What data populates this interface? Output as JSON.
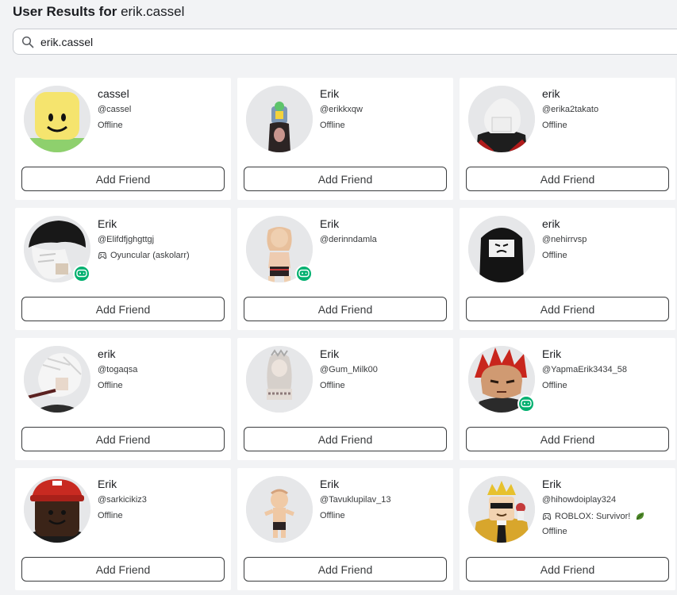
{
  "header": {
    "prefix": "User Results for",
    "query": "erik.cassel"
  },
  "search": {
    "value": "erik.cassel"
  },
  "add_friend_label": "Add Friend",
  "results": [
    {
      "display_name": "cassel",
      "username": "@cassel",
      "status": "Offline",
      "status2": "",
      "game": false,
      "avatar": "noob-yellow"
    },
    {
      "display_name": "Erik",
      "username": "@erikkxqw",
      "status": "Offline",
      "status2": "",
      "game": false,
      "avatar": "figure-mask"
    },
    {
      "display_name": "erik",
      "username": "@erika2takato",
      "status": "Offline",
      "status2": "",
      "game": false,
      "avatar": "white-hair-red"
    },
    {
      "display_name": "Erik",
      "username": "@Elifdfjghgttgj",
      "status": "Oyuncular (askolarr)",
      "status2": "",
      "game": true,
      "avatar": "black-beanie"
    },
    {
      "display_name": "Erik",
      "username": "@derinndamla",
      "status": "",
      "status2": "",
      "game": true,
      "avatar": "blonde-figure"
    },
    {
      "display_name": "erik",
      "username": "@nehirrvsp",
      "status": "Offline",
      "status2": "",
      "game": false,
      "avatar": "black-hair"
    },
    {
      "display_name": "erik",
      "username": "@togaqsa",
      "status": "Offline",
      "status2": "",
      "game": false,
      "avatar": "white-hair-sword"
    },
    {
      "display_name": "Erik",
      "username": "@Gum_Milk00",
      "status": "Offline",
      "status2": "",
      "game": false,
      "avatar": "faded-figure"
    },
    {
      "display_name": "Erik",
      "username": "@YapmaErik3434_58",
      "status": "Offline",
      "status2": "",
      "game": true,
      "avatar": "red-spiky"
    },
    {
      "display_name": "Erik",
      "username": "@sarkicikiz3",
      "status": "Offline",
      "status2": "",
      "game": false,
      "avatar": "red-cap"
    },
    {
      "display_name": "Erik",
      "username": "@Tavuklupilav_13",
      "status": "Offline",
      "status2": "",
      "game": false,
      "avatar": "small-figure"
    },
    {
      "display_name": "Erik",
      "username": "@hihowdoiplay324",
      "status": "ROBLOX: Survivor!",
      "status2": "Offline",
      "game": false,
      "avatar": "crown-gold"
    }
  ]
}
